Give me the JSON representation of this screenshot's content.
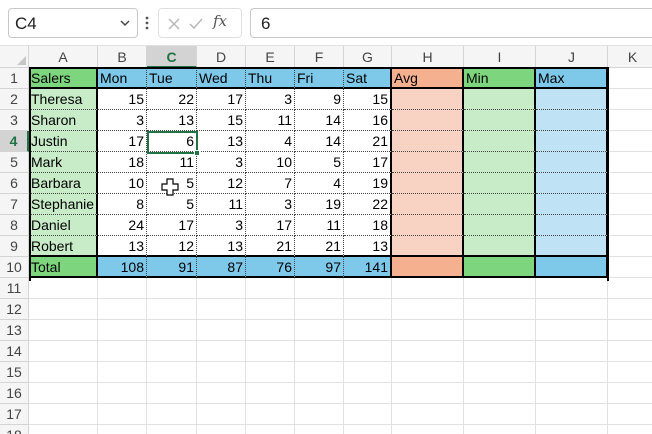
{
  "formula_bar": {
    "name_box": "C4",
    "formula": "6",
    "fx_label": "fx"
  },
  "columns": [
    "A",
    "B",
    "C",
    "D",
    "E",
    "F",
    "G",
    "H",
    "I",
    "J",
    "K"
  ],
  "row_numbers": [
    "1",
    "2",
    "3",
    "4",
    "5",
    "6",
    "7",
    "8",
    "9",
    "10",
    "11",
    "12",
    "13",
    "14",
    "15",
    "16",
    "17",
    "18"
  ],
  "headers": [
    "Salers",
    "Mon",
    "Tue",
    "Wed",
    "Thu",
    "Fri",
    "Sat",
    "Avg",
    "Min",
    "Max"
  ],
  "rows": [
    {
      "name": "Theresa",
      "values": [
        "15",
        "22",
        "17",
        "3",
        "9",
        "15"
      ]
    },
    {
      "name": "Sharon",
      "values": [
        "3",
        "13",
        "15",
        "11",
        "14",
        "16"
      ]
    },
    {
      "name": "Justin",
      "values": [
        "17",
        "6",
        "13",
        "4",
        "14",
        "21"
      ]
    },
    {
      "name": "Mark",
      "values": [
        "18",
        "11",
        "3",
        "10",
        "5",
        "17"
      ]
    },
    {
      "name": "Barbara",
      "values": [
        "10",
        "5",
        "12",
        "7",
        "4",
        "19"
      ]
    },
    {
      "name": "Stephanie",
      "values": [
        "8",
        "5",
        "11",
        "3",
        "19",
        "22"
      ]
    },
    {
      "name": "Daniel",
      "values": [
        "24",
        "17",
        "3",
        "17",
        "11",
        "18"
      ]
    },
    {
      "name": "Robert",
      "values": [
        "13",
        "12",
        "13",
        "21",
        "21",
        "13"
      ]
    }
  ],
  "total": {
    "label": "Total",
    "values": [
      "108",
      "91",
      "87",
      "76",
      "97",
      "141"
    ]
  },
  "selected_cell": {
    "column": "C",
    "row": "4"
  },
  "colors": {
    "salers_fill": "#c8ecc8",
    "day_fill": "#bfe3f5",
    "avg_fill": "#f8d2c2",
    "min_fill": "#c8ecc8",
    "max_fill": "#bfe3f5",
    "accent": "#217346"
  }
}
